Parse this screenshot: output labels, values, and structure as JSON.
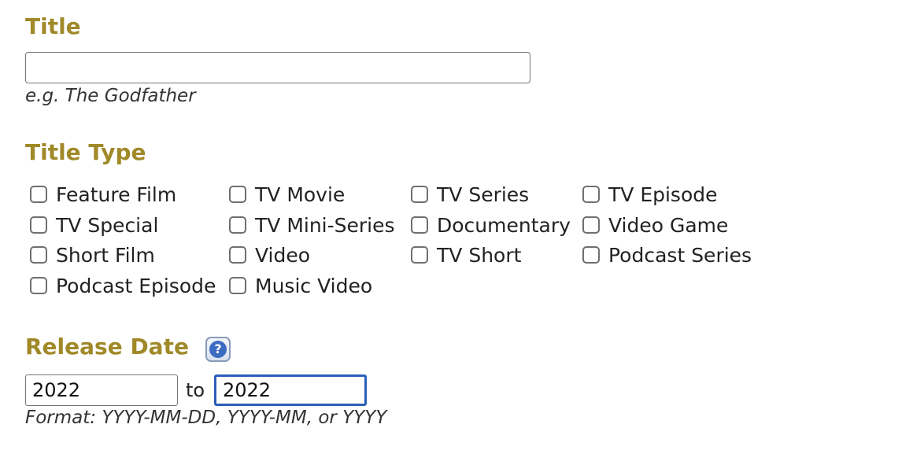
{
  "title_section": {
    "heading": "Title",
    "input_value": "",
    "hint": "e.g. The Godfather"
  },
  "title_type_section": {
    "heading": "Title Type",
    "options": [
      {
        "label": "Feature Film",
        "checked": false
      },
      {
        "label": "TV Movie",
        "checked": false
      },
      {
        "label": "TV Series",
        "checked": false
      },
      {
        "label": "TV Episode",
        "checked": false
      },
      {
        "label": "TV Special",
        "checked": false
      },
      {
        "label": "TV Mini-Series",
        "checked": false
      },
      {
        "label": "Documentary",
        "checked": false
      },
      {
        "label": "Video Game",
        "checked": false
      },
      {
        "label": "Short Film",
        "checked": false
      },
      {
        "label": "Video",
        "checked": false
      },
      {
        "label": "TV Short",
        "checked": false
      },
      {
        "label": "Podcast Series",
        "checked": false
      },
      {
        "label": "Podcast Episode",
        "checked": false
      },
      {
        "label": "Music Video",
        "checked": false
      }
    ]
  },
  "release_date_section": {
    "heading": "Release Date",
    "help_icon": "question-mark-icon",
    "help_glyph": "?",
    "from_value": "2022",
    "to_label": "to",
    "to_value": "2022",
    "hint": "Format: YYYY-MM-DD, YYYY-MM, or YYYY"
  },
  "colors": {
    "heading": "#a08928",
    "focus_border": "#2b5fb8",
    "help_icon": "#3c6cc2"
  }
}
